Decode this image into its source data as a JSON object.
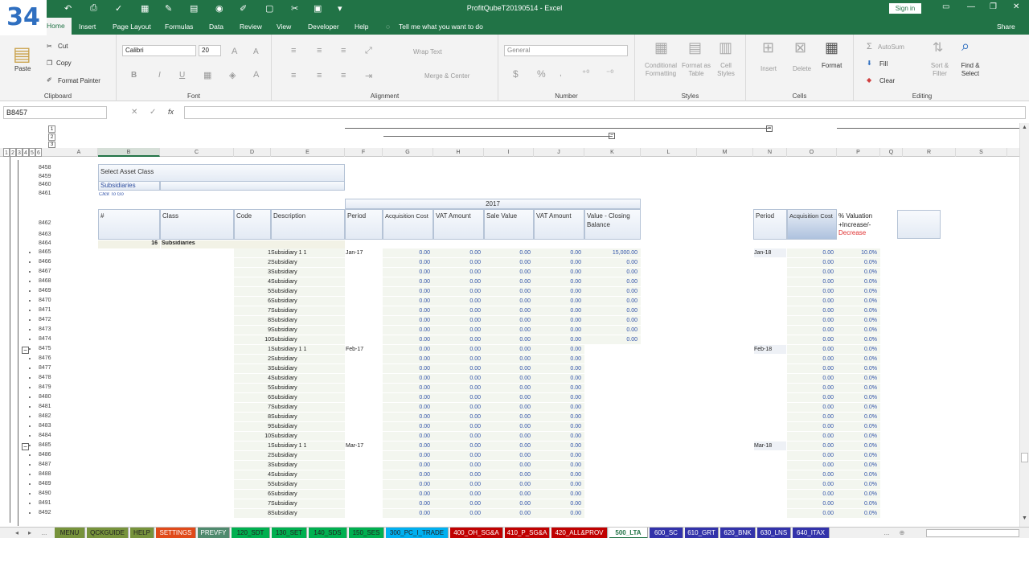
{
  "window": {
    "title": "ProfitQubeT20190514  -  Excel",
    "signin": "Sign in",
    "badge": "34"
  },
  "ribbon_tabs": [
    "Home",
    "Insert",
    "Page Layout",
    "Formulas",
    "Data",
    "Review",
    "View",
    "Developer",
    "Help",
    "Tell me what you want to do",
    "Share"
  ],
  "clipboard": {
    "paste": "Paste",
    "cut": "Cut",
    "copy": "Copy",
    "format_painter": "Format Painter",
    "label": "Clipboard"
  },
  "font": {
    "name": "Calibri",
    "size": "20",
    "label": "Font",
    "bold": "B",
    "italic": "I",
    "underline": "U"
  },
  "alignment": {
    "wrap": "Wrap Text",
    "merge": "Merge & Center",
    "label": "Alignment"
  },
  "number": {
    "format": "General",
    "label": "Number",
    "currency": "$",
    "percent": "%"
  },
  "styles": {
    "conditional": "Conditional Formatting",
    "format_table": "Format as Table",
    "cell_styles": "Cell Styles",
    "label": "Styles"
  },
  "cells": {
    "insert": "Insert",
    "delete": "Delete",
    "format": "Format",
    "label": "Cells"
  },
  "editing": {
    "autosum": "AutoSum",
    "fill": "Fill",
    "clear": "Clear",
    "sort": "Sort & Filter",
    "find": "Find & Select",
    "label": "Editing"
  },
  "namebox": "B8457",
  "fx": "fx",
  "columns": [
    [
      "A",
      75,
      47
    ],
    [
      "B",
      122,
      77
    ],
    [
      "C",
      199,
      92
    ],
    [
      "D",
      291,
      46
    ],
    [
      "E",
      337,
      92
    ],
    [
      "F",
      429,
      47
    ],
    [
      "G",
      476,
      63
    ],
    [
      "H",
      539,
      63
    ],
    [
      "I",
      602,
      62
    ],
    [
      "J",
      664,
      63
    ],
    [
      "K",
      727,
      70
    ],
    [
      "L",
      797,
      70
    ],
    [
      "M",
      867,
      70
    ],
    [
      "N",
      937,
      42
    ],
    [
      "O",
      979,
      62
    ],
    [
      "P",
      1041,
      54
    ],
    [
      "Q",
      1095,
      28
    ],
    [
      "R",
      1123,
      66
    ],
    [
      "S",
      1189,
      64
    ]
  ],
  "outline_levels": [
    "1",
    "2",
    "3",
    "4",
    "5",
    "6"
  ],
  "sheet": {
    "select_label": "Select Asset Class",
    "select_value": "Subsidiaries",
    "click_to_go": "Click To Go",
    "year": "2017",
    "headers": [
      "#",
      "Class",
      "Code",
      "Description",
      "Period",
      "Acquisition Cost",
      "VAT Amount",
      "Sale Value",
      "VAT Amount",
      "Value - Closing Balance"
    ],
    "right_headers": [
      "Period",
      "Acquisition Cost",
      "% Valuation +Increase/-"
    ],
    "decrease": "Decrease",
    "total_num": "16",
    "total_class": "Subsidiaries",
    "zero": "0.00",
    "closing_first": "15,000.00",
    "pct_first": "10.0%",
    "pct_zero": "0.0%",
    "sub_first": "Subsidiary 1",
    "sub": "Subsidiary",
    "periods": [
      "Jan-17",
      "Feb-17",
      "Mar-17"
    ],
    "right_periods": [
      "Jan-18",
      "Feb-18",
      "Mar-18"
    ]
  },
  "row_numbers": [
    "8458",
    "8459",
    "8460",
    "8461",
    "8462",
    "8463",
    "8464",
    "8465",
    "8466",
    "8467",
    "8468",
    "8469",
    "8470",
    "8471",
    "8472",
    "8473",
    "8474",
    "8475",
    "8476",
    "8477",
    "8478",
    "8479",
    "8480",
    "8481",
    "8482",
    "8483",
    "8484",
    "8485",
    "8486",
    "8487",
    "8488",
    "8489",
    "8490",
    "8491",
    "8492"
  ],
  "sheet_tabs": [
    [
      "MENU",
      "#77933c"
    ],
    [
      "QCKGUIDE",
      "#77933c"
    ],
    [
      "HELP",
      "#77933c"
    ],
    [
      "SETTINGS",
      "#e04a1a"
    ],
    [
      "PREVFY",
      "#4f8a6e"
    ],
    [
      "120_SDT",
      "#00b050"
    ],
    [
      "130_SET",
      "#00b050"
    ],
    [
      "140_SDS",
      "#00b050"
    ],
    [
      "150_SES",
      "#00b050"
    ],
    [
      "300_PC_I_TRADE",
      "#00b0f0"
    ],
    [
      "400_OH_SG&A",
      "#c00000"
    ],
    [
      "410_P_SG&A",
      "#c00000"
    ],
    [
      "420_ALL&PROV",
      "#c00000"
    ],
    [
      "500_LTA",
      "#ffffff"
    ],
    [
      "600_SC",
      "#3333aa"
    ],
    [
      "610_GRT",
      "#3333aa"
    ],
    [
      "620_BNK",
      "#3333aa"
    ],
    [
      "630_LNS",
      "#3333aa"
    ],
    [
      "640_ITAX",
      "#3333aa"
    ]
  ],
  "tab_more": "...",
  "colors": {
    "excel_green": "#217346",
    "ribbon_bg": "#f3f3f3",
    "data_blue": "#3355aa",
    "decrease_red": "#e03030"
  }
}
